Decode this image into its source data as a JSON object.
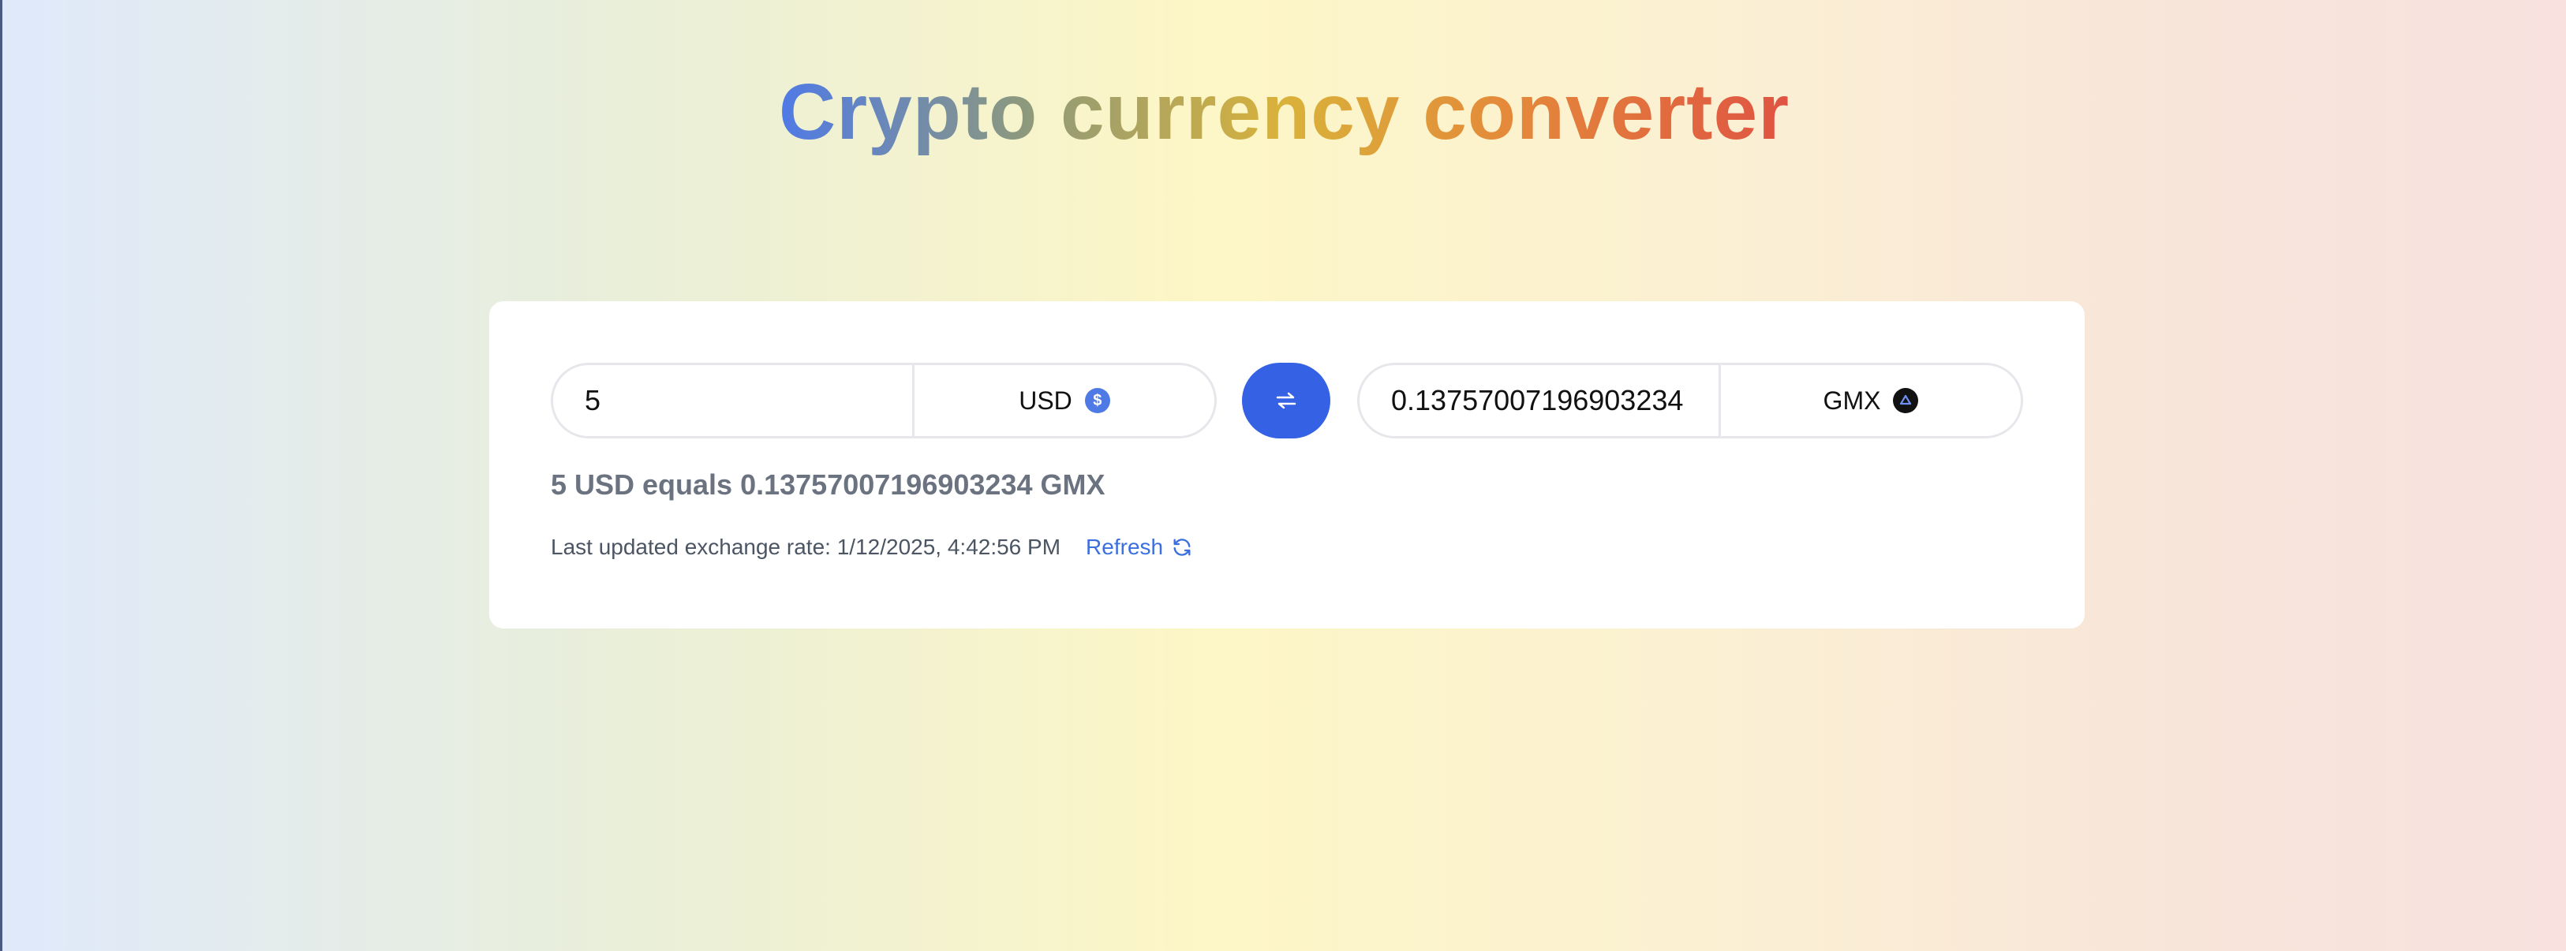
{
  "page": {
    "title": "Crypto currency converter"
  },
  "converter": {
    "from": {
      "amount": "5",
      "currency": "USD",
      "icon": "usd-coin-icon"
    },
    "to": {
      "amount": "0.13757007196903234",
      "currency": "GMX",
      "icon": "gmx-coin-icon"
    },
    "swap_icon": "swap-arrows-icon",
    "result_text": "5 USD equals 0.13757007196903234 GMX",
    "last_updated_text": "Last updated exchange rate: 1/12/2025, 4:42:56 PM",
    "refresh_label": "Refresh",
    "refresh_icon": "refresh-icon"
  },
  "colors": {
    "accent": "#3562e4",
    "link": "#3b6fe0"
  }
}
